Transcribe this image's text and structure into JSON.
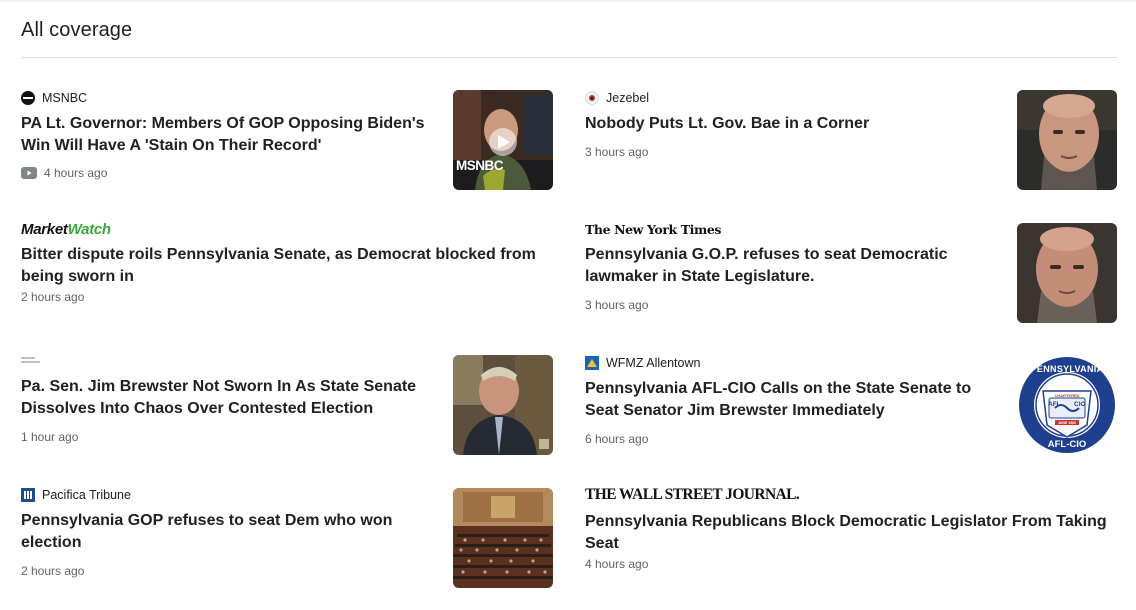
{
  "section": {
    "title": "All coverage"
  },
  "articles": [
    {
      "source": "MSNBC",
      "headline": "PA Lt. Governor: Members Of GOP Opposing Biden's Win Will Have A 'Stain On Their Record'",
      "time": "4 hours ago",
      "thumb_label": "MSNBC",
      "has_video": true
    },
    {
      "source": "Jezebel",
      "headline": "Nobody Puts Lt. Gov. Bae in a Corner",
      "time": "3 hours ago"
    },
    {
      "source": "MarketWatch",
      "headline": "Bitter dispute roils Pennsylvania Senate, as Democrat blocked from being sworn in",
      "time": "2 hours ago"
    },
    {
      "source": "The New York Times",
      "headline": "Pennsylvania G.O.P. refuses to seat Democratic lawmaker in State Legislature.",
      "time": "3 hours ago"
    },
    {
      "source": "",
      "headline": "Pa. Sen. Jim Brewster Not Sworn In As State Senate Dissolves Into Chaos Over Contested Election",
      "time": "1 hour ago"
    },
    {
      "source": "WFMZ Allentown",
      "headline": "Pennsylvania AFL-CIO Calls on the State Senate to Seat Senator Jim Brewster Immediately",
      "time": "6 hours ago",
      "thumb_text": {
        "top": "PENNSYLVANIA",
        "bottom": "AFL-CIO",
        "left": "AFL",
        "right": "CIO",
        "banner": "CHARTERED",
        "date": "JUNE 1960"
      }
    },
    {
      "source": "Pacifica Tribune",
      "headline": "Pennsylvania GOP refuses to seat Dem who won election",
      "time": "2 hours ago"
    },
    {
      "source": "THE WALL STREET JOURNAL.",
      "headline": "Pennsylvania Republicans Block Democratic Legislator From Taking Seat",
      "time": "4 hours ago"
    }
  ],
  "logos": {
    "marketwatch_a": "Market",
    "marketwatch_b": "Watch"
  },
  "colors": {
    "text": "#202124",
    "meta": "#5f6368",
    "divider": "#dadce0",
    "marketwatch_green": "#3aa83a",
    "aflcio_blue": "#1f3f8f"
  },
  "icons": {
    "video": "youtube-play-icon"
  }
}
